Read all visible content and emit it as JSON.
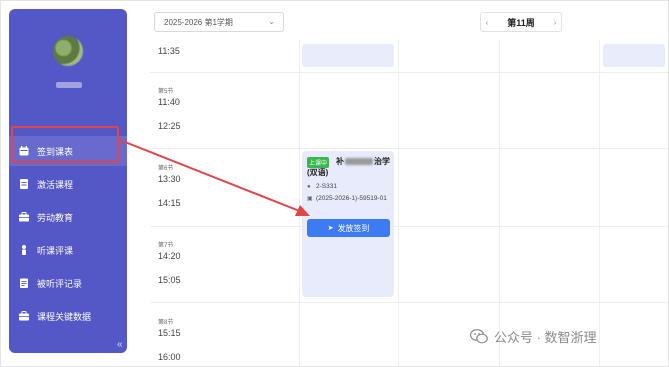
{
  "sidebar": {
    "username": "",
    "items": [
      {
        "label": "签到课表",
        "icon": "calendar-icon",
        "active": true
      },
      {
        "label": "激活课程",
        "icon": "document-icon",
        "active": false
      },
      {
        "label": "劳动教育",
        "icon": "briefcase-icon",
        "active": false
      },
      {
        "label": "听课评课",
        "icon": "person-icon",
        "active": false
      },
      {
        "label": "被听评记录",
        "icon": "clipboard-icon",
        "active": false
      },
      {
        "label": "课程关键数据",
        "icon": "briefcase-icon",
        "active": false
      }
    ],
    "collapse_glyph": "«"
  },
  "toolbar": {
    "term": "2025-2026 第1学期",
    "prev": "‹",
    "week": "第11周",
    "next": "›"
  },
  "slots": [
    {
      "name": "",
      "start": "",
      "end": "11:35"
    },
    {
      "name": "第5节",
      "start": "11:40",
      "end": "12:25"
    },
    {
      "name": "第6节",
      "start": "13:30",
      "end": "14:15"
    },
    {
      "name": "第7节",
      "start": "14:20",
      "end": "15:05"
    },
    {
      "name": "第8节",
      "start": "15:15",
      "end": "16:00"
    }
  ],
  "course_card": {
    "status_tag": "上课中",
    "title_prefix": "补",
    "title_suffix": "治学",
    "title_line2": "(双语)",
    "room": "2-S331",
    "class_code": "(2025-2026-1)-59519-01",
    "send_button": "发放签到"
  },
  "watermark": {
    "text": "公众号 · 数智浙理"
  },
  "colors": {
    "sidebar_bg": "#5457c6",
    "card_bg": "#e7ebfb",
    "button_blue": "#3d7bf5",
    "status_green": "#3ab64f",
    "annotation_red": "#e0454a"
  }
}
